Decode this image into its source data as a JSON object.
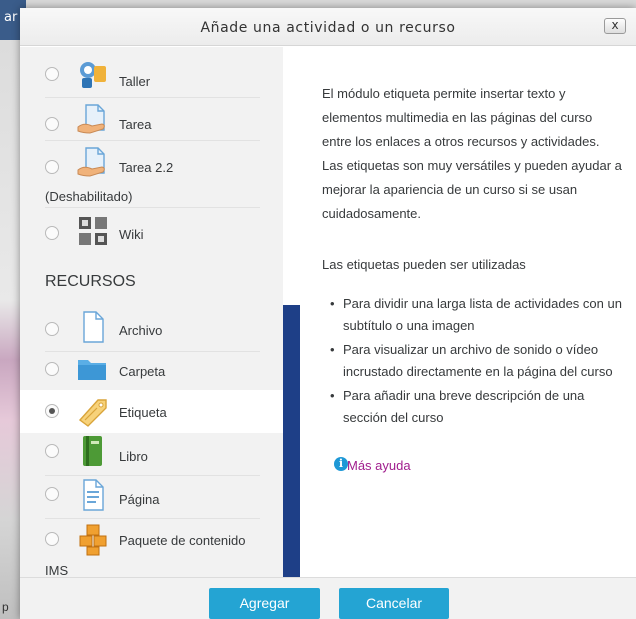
{
  "background": {
    "header_fragment": "ar",
    "footer_fragment": "p"
  },
  "dialog": {
    "title": "Añade una actividad o un recurso",
    "close_label": "x"
  },
  "options": {
    "items": [
      {
        "label": "Taller",
        "icon": "workshop-icon",
        "checked": false
      },
      {
        "label": "Tarea",
        "icon": "assignment-icon",
        "checked": false
      },
      {
        "label": "Tarea 2.2",
        "sublabel": "(Deshabilitado)",
        "icon": "assignment-icon",
        "checked": false
      },
      {
        "label": "Wiki",
        "icon": "wiki-icon",
        "checked": false
      },
      {
        "label": "Archivo",
        "icon": "file-icon",
        "checked": false
      },
      {
        "label": "Carpeta",
        "icon": "folder-icon",
        "checked": false
      },
      {
        "label": "Etiqueta",
        "icon": "label-tag-icon",
        "checked": true
      },
      {
        "label": "Libro",
        "icon": "book-icon",
        "checked": false
      },
      {
        "label": "Página",
        "icon": "page-icon",
        "checked": false
      },
      {
        "label": "Paquete de contenido",
        "sublabel": "IMS",
        "icon": "package-icon",
        "checked": false
      }
    ],
    "section_resources": "RECURSOS"
  },
  "help": {
    "para1": "El módulo etiqueta permite insertar texto y elementos multimedia en las páginas del curso entre los enlaces a otros recursos y actividades. Las etiquetas son muy versátiles y pueden ayudar a mejorar la apariencia de un curso si se usan cuidadosamente.",
    "para2": "Las etiquetas pueden ser utilizadas",
    "bullets": [
      "Para dividir una larga lista de actividades con un subtítulo o una imagen",
      "Para visualizar un archivo de sonido o vídeo incrustado directamente en la página del curso",
      "Para añadir una breve descripción de una sección del curso"
    ],
    "more_help": "Más ayuda",
    "info_glyph": "i"
  },
  "footer": {
    "add_label": "Agregar",
    "cancel_label": "Cancelar"
  },
  "colors": {
    "accent_button": "#24a4d3",
    "link": "#a01d8d",
    "scroll_accent": "#1e3f87"
  }
}
